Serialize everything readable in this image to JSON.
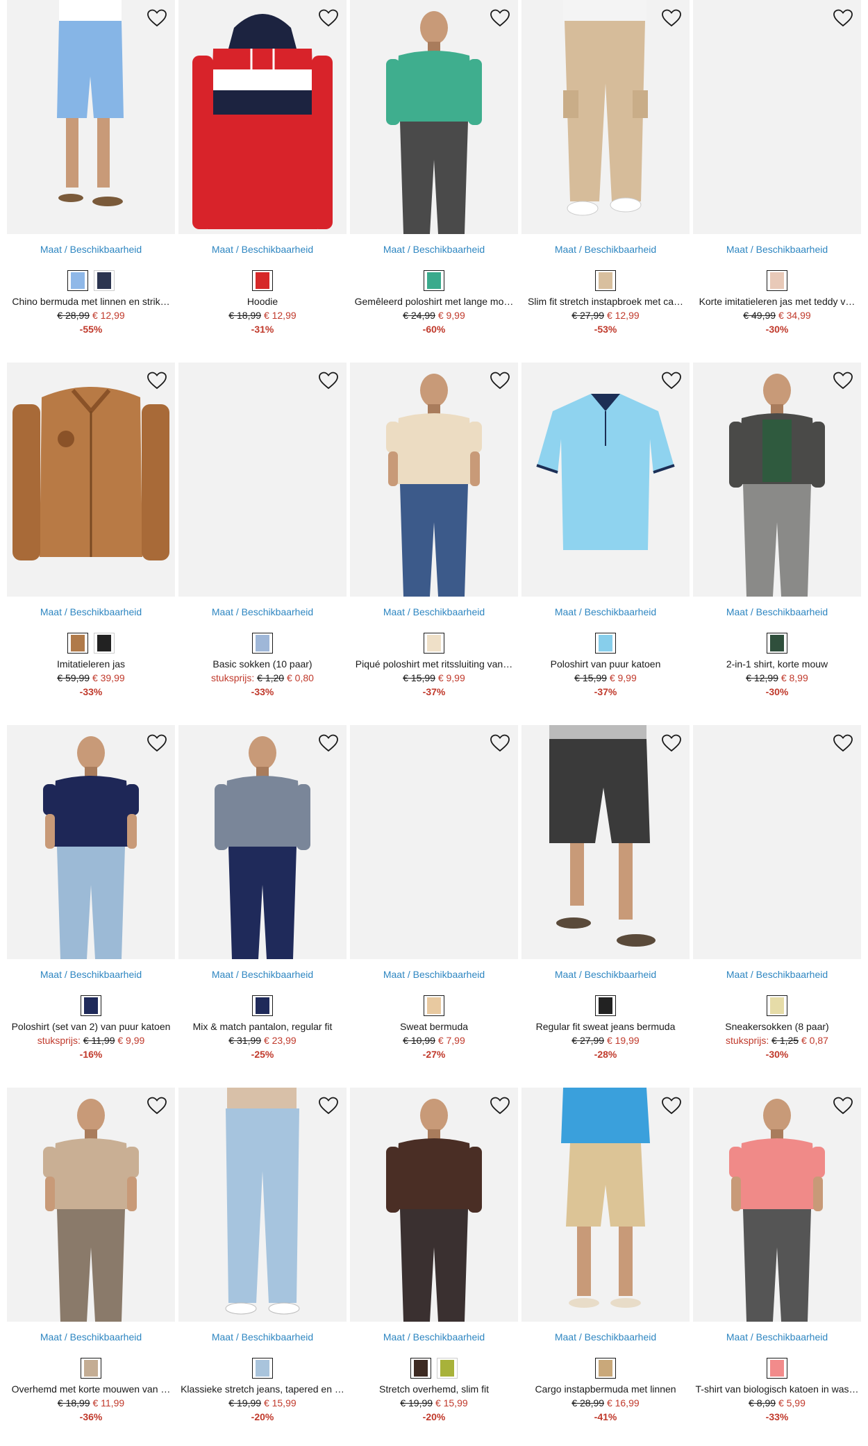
{
  "size_label": "Maat / Beschikbaarheid",
  "unit_label": "stuksprijs:",
  "colors": {
    "accent": "#2e86c1",
    "sale": "#c0392b"
  },
  "products": [
    {
      "title": "Chino bermuda met linnen en strik…",
      "old": "€ 28,99",
      "new": "€ 12,99",
      "disc": "-55%",
      "swatches": [
        "#8fb8e8",
        "#2c3550"
      ],
      "kind": "shorts-blue"
    },
    {
      "title": "Hoodie",
      "old": "€ 18,99",
      "new": "€ 12,99",
      "disc": "-31%",
      "swatches": [
        "#d62828"
      ],
      "kind": "hoodie"
    },
    {
      "title": "Gemêleerd poloshirt met lange mo…",
      "old": "€ 24,99",
      "new": "€ 9,99",
      "disc": "-60%",
      "swatches": [
        "#3aaa8c"
      ],
      "kind": "polo-green"
    },
    {
      "title": "Slim fit stretch instapbroek met ca…",
      "old": "€ 27,99",
      "new": "€ 12,99",
      "disc": "-53%",
      "swatches": [
        "#d8bf9e"
      ],
      "kind": "cargo-beige"
    },
    {
      "title": "Korte imitatieleren jas met teddy v…",
      "old": "€ 49,99",
      "new": "€ 34,99",
      "disc": "-30%",
      "swatches": [
        "#e8c9b8"
      ],
      "kind": "empty"
    },
    {
      "title": "Imitatieleren jas",
      "old": "€ 59,99",
      "new": "€ 39,99",
      "disc": "-33%",
      "swatches": [
        "#b07a4a",
        "#222222"
      ],
      "kind": "leather"
    },
    {
      "title": "Basic sokken (10 paar)",
      "unit": true,
      "old": "€ 1,20",
      "new": "€ 0,80",
      "disc": "-33%",
      "swatches": [
        "#9fb7d8"
      ],
      "kind": "empty"
    },
    {
      "title": "Piqué poloshirt met ritssluiting van…",
      "old": "€ 15,99",
      "new": "€ 9,99",
      "disc": "-37%",
      "swatches": [
        "#efe0c8"
      ],
      "kind": "polo-cream"
    },
    {
      "title": "Poloshirt van puur katoen",
      "old": "€ 15,99",
      "new": "€ 9,99",
      "disc": "-37%",
      "swatches": [
        "#87ceeb"
      ],
      "kind": "polo-blue"
    },
    {
      "title": "2-in-1 shirt, korte mouw",
      "old": "€ 12,99",
      "new": "€ 8,99",
      "disc": "-30%",
      "swatches": [
        "#2f4f3c"
      ],
      "kind": "layered"
    },
    {
      "title": "Poloshirt (set van 2) van puur katoen",
      "unit": true,
      "old": "€ 11,99",
      "new": "€ 9,99",
      "disc": "-16%",
      "swatches": [
        "#1f2a5a"
      ],
      "kind": "polo-navy"
    },
    {
      "title": "Mix & match pantalon, regular fit",
      "old": "€ 31,99",
      "new": "€ 23,99",
      "disc": "-25%",
      "swatches": [
        "#1f2a5a"
      ],
      "kind": "pantalon"
    },
    {
      "title": "Sweat bermuda",
      "old": "€ 10,99",
      "new": "€ 7,99",
      "disc": "-27%",
      "swatches": [
        "#e8c9a0"
      ],
      "kind": "empty"
    },
    {
      "title": "Regular fit sweat jeans bermuda",
      "old": "€ 27,99",
      "new": "€ 19,99",
      "disc": "-28%",
      "swatches": [
        "#222222"
      ],
      "kind": "shorts-black"
    },
    {
      "title": "Sneakersokken (8 paar)",
      "unit": true,
      "old": "€ 1,25",
      "new": "€ 0,87",
      "disc": "-30%",
      "swatches": [
        "#e6dca8"
      ],
      "kind": "empty"
    },
    {
      "title": "Overhemd met korte mouwen van …",
      "old": "€ 18,99",
      "new": "€ 11,99",
      "disc": "-36%",
      "swatches": [
        "#c4ad94"
      ],
      "kind": "shirt-print"
    },
    {
      "title": "Klassieke stretch jeans, tapered en …",
      "old": "€ 19,99",
      "new": "€ 15,99",
      "disc": "-20%",
      "swatches": [
        "#a9c4dc"
      ],
      "kind": "jeans"
    },
    {
      "title": "Stretch overhemd, slim fit",
      "old": "€ 19,99",
      "new": "€ 15,99",
      "disc": "-20%",
      "swatches": [
        "#3d2a22",
        "#a8b23a"
      ],
      "kind": "shirt-brown"
    },
    {
      "title": "Cargo instapbermuda met linnen",
      "old": "€ 28,99",
      "new": "€ 16,99",
      "disc": "-41%",
      "swatches": [
        "#c9a87a"
      ],
      "kind": "shorts-beige"
    },
    {
      "title": "T-shirt van biologisch katoen in was…",
      "old": "€ 8,99",
      "new": "€ 5,99",
      "disc": "-33%",
      "swatches": [
        "#f28b8b"
      ],
      "kind": "tee-pink"
    }
  ]
}
